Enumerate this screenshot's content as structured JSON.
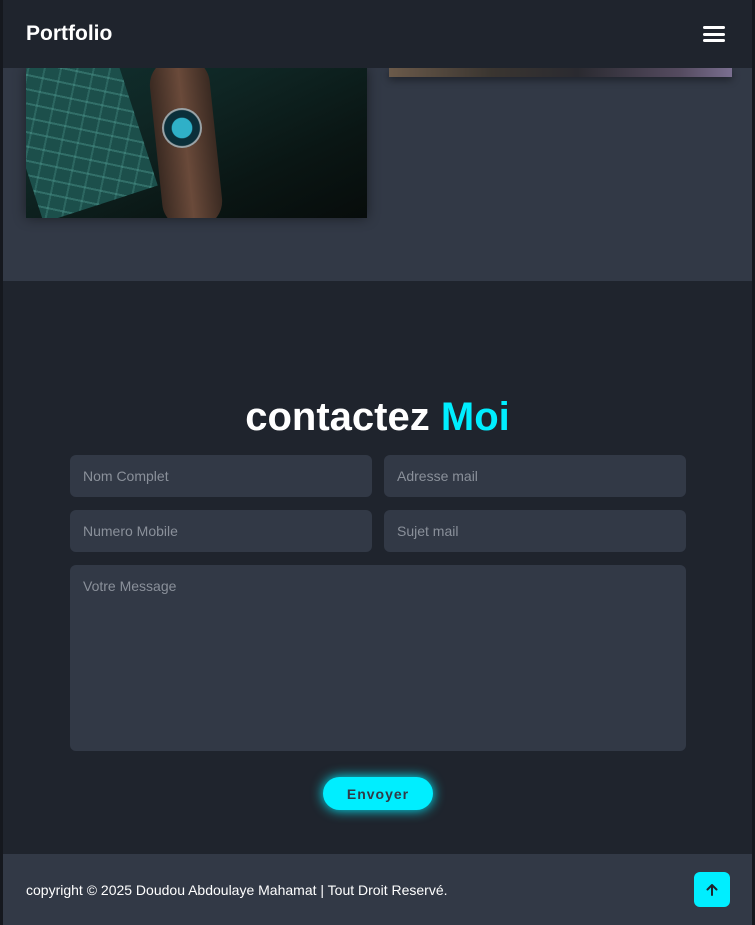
{
  "header": {
    "logo": "Portfolio",
    "menu_icon": "hamburger-menu-icon"
  },
  "portfolio": {
    "items": [
      {
        "image": "portfolio-image-watch"
      },
      {
        "image": "portfolio-image-2"
      }
    ]
  },
  "contact": {
    "title_main": "contactez",
    "title_accent": "Moi",
    "fields": {
      "name_placeholder": "Nom Complet",
      "email_placeholder": "Adresse mail",
      "phone_placeholder": "Numero Mobile",
      "subject_placeholder": "Sujet mail",
      "message_placeholder": "Votre Message"
    },
    "submit_label": "Envoyer"
  },
  "footer": {
    "copyright": "copyright © 2025 Doudou Abdoulaye Mahamat | Tout Droit Reservé.",
    "top_icon": "arrow-up-icon"
  },
  "colors": {
    "accent": "#00eeff",
    "bg": "#1f242d",
    "bg_secondary": "#323946"
  }
}
